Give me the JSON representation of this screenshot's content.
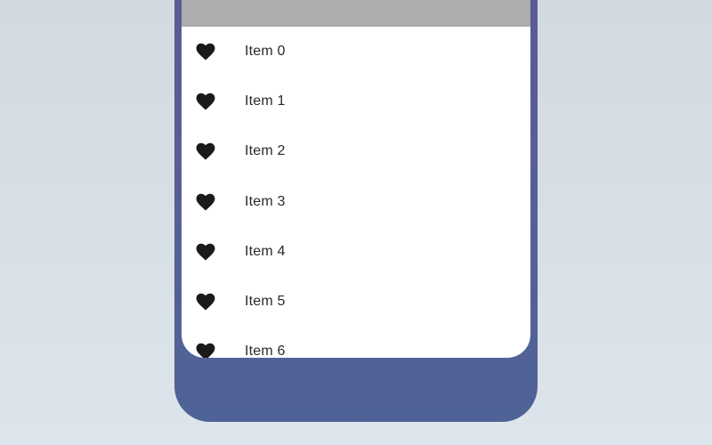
{
  "colors": {
    "background": "#d6dde5",
    "device_frame": "#55619a",
    "top_bar": "#adacae",
    "icon": "#1a1a1a",
    "text": "#2a2a2a"
  },
  "list": {
    "icon": "heart-icon",
    "items": [
      {
        "label": "Item 0"
      },
      {
        "label": "Item 1"
      },
      {
        "label": "Item 2"
      },
      {
        "label": "Item 3"
      },
      {
        "label": "Item 4"
      },
      {
        "label": "Item 5"
      },
      {
        "label": "Item 6"
      }
    ]
  }
}
